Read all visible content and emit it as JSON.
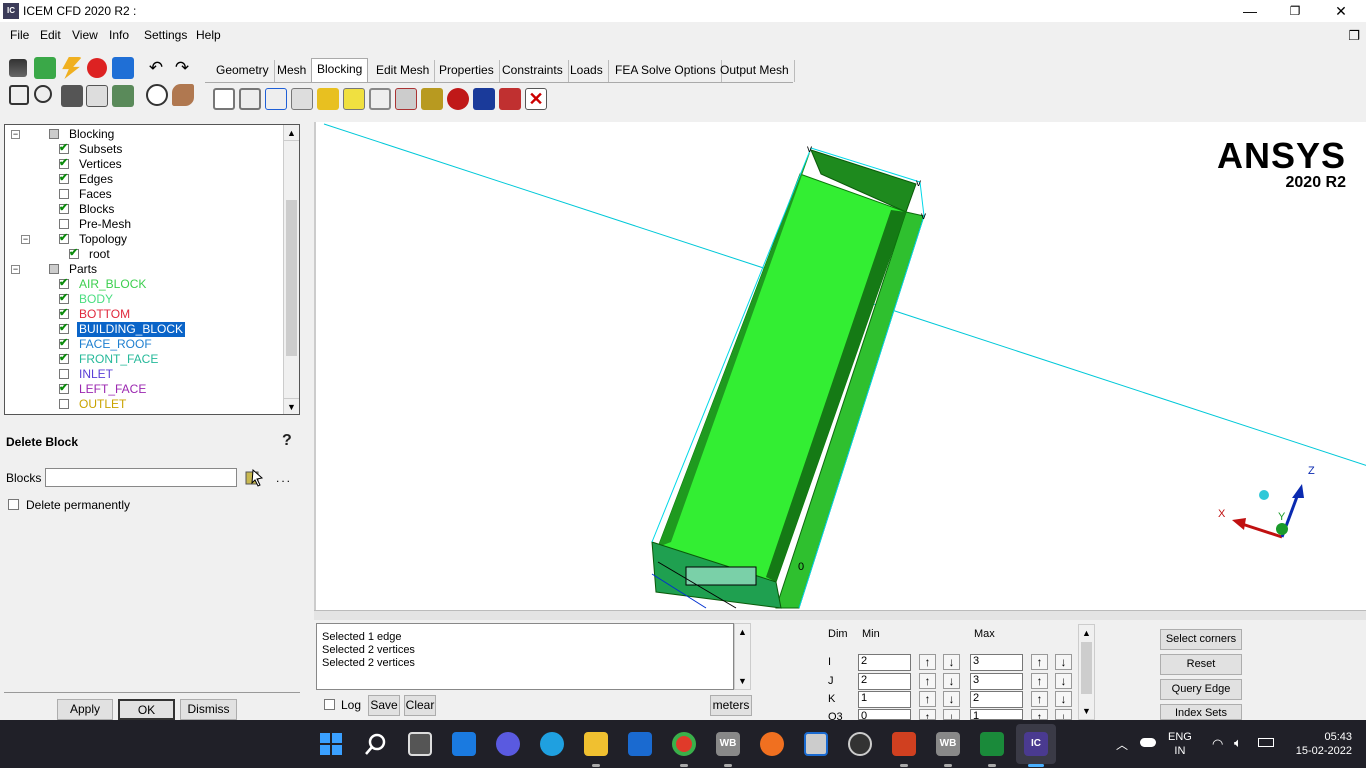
{
  "window": {
    "title": "ICEM CFD 2020 R2 :",
    "app_icon": "IC",
    "minimize": "—",
    "maximize": "❐",
    "close": "✕"
  },
  "menu": [
    "File",
    "Edit",
    "View",
    "Info",
    "Settings",
    "Help"
  ],
  "tabs": [
    {
      "label": "Geometry",
      "active": false
    },
    {
      "label": "Mesh",
      "active": false
    },
    {
      "label": "Blocking",
      "active": true
    },
    {
      "label": "Edit Mesh",
      "active": false
    },
    {
      "label": "Properties",
      "active": false
    },
    {
      "label": "Constraints",
      "active": false
    },
    {
      "label": "Loads",
      "active": false
    },
    {
      "label": "FEA Solve Options",
      "active": false
    },
    {
      "label": "Output Mesh",
      "active": false
    }
  ],
  "tree": {
    "items": [
      {
        "label": "Blocking",
        "level": 0,
        "checked": "partial",
        "expander": "⊟",
        "color": "#000000"
      },
      {
        "label": "Subsets",
        "level": 1,
        "checked": true,
        "color": "#000000"
      },
      {
        "label": "Vertices",
        "level": 1,
        "checked": true,
        "color": "#000000"
      },
      {
        "label": "Edges",
        "level": 1,
        "checked": true,
        "color": "#000000"
      },
      {
        "label": "Faces",
        "level": 1,
        "checked": false,
        "color": "#000000"
      },
      {
        "label": "Blocks",
        "level": 1,
        "checked": true,
        "color": "#000000"
      },
      {
        "label": "Pre-Mesh",
        "level": 1,
        "checked": false,
        "color": "#000000"
      },
      {
        "label": "Topology",
        "level": 1,
        "checked": true,
        "expander": "⊟",
        "color": "#000000"
      },
      {
        "label": "root",
        "level": 2,
        "checked": true,
        "color": "#000000"
      },
      {
        "label": "Parts",
        "level": 0,
        "checked": "partial",
        "expander": "⊟",
        "color": "#000000"
      },
      {
        "label": "AIR_BLOCK",
        "level": 1,
        "checked": true,
        "color": "#3ccf4e"
      },
      {
        "label": "BODY",
        "level": 1,
        "checked": true,
        "color": "#4ade80"
      },
      {
        "label": "BOTTOM",
        "level": 1,
        "checked": true,
        "color": "#e0283c"
      },
      {
        "label": "BUILDING_BLOCK",
        "level": 1,
        "checked": true,
        "color": "#ffffff",
        "selected": true
      },
      {
        "label": "FACE_ROOF",
        "level": 1,
        "checked": true,
        "color": "#1e7fd0"
      },
      {
        "label": "FRONT_FACE",
        "level": 1,
        "checked": true,
        "color": "#26b99a"
      },
      {
        "label": "INLET",
        "level": 1,
        "checked": false,
        "color": "#5a3fd6"
      },
      {
        "label": "LEFT_FACE",
        "level": 1,
        "checked": true,
        "color": "#9b27b0"
      },
      {
        "label": "OUTLET",
        "level": 1,
        "checked": false,
        "color": "#c9a300"
      }
    ]
  },
  "form": {
    "title": "Delete Block",
    "help": "?",
    "blocks_label": "Blocks",
    "blocks_value": "",
    "more": "...",
    "delete_permanently": "Delete permanently",
    "buttons": {
      "apply": "Apply",
      "ok": "OK",
      "dismiss": "Dismiss"
    }
  },
  "viewport": {
    "logo_name": "ANSYS",
    "logo_version": "2020 R2",
    "axes": {
      "x": "X",
      "y": "Y",
      "z": "Z"
    },
    "vertex_labels": [
      "0"
    ],
    "accent_green": "#33ee33",
    "line_cyan": "#00c8d8"
  },
  "messages": {
    "lines": [
      "Selected 1 edge",
      "Selected 2 vertices",
      "Selected 2 vertices"
    ],
    "log_label": "Log",
    "save": "Save",
    "clear": "Clear",
    "units": "meters"
  },
  "index_control": {
    "headers": {
      "dim": "Dim",
      "min": "Min",
      "max": "Max"
    },
    "rows": [
      {
        "dim": "I",
        "min": "2",
        "max": "3"
      },
      {
        "dim": "J",
        "min": "2",
        "max": "3"
      },
      {
        "dim": "K",
        "min": "1",
        "max": "2"
      },
      {
        "dim": "O3",
        "min": "0",
        "max": "1"
      }
    ],
    "buttons": [
      "Select corners",
      "Reset",
      "Query Edge",
      "Index Sets"
    ]
  },
  "taskbar": {
    "lang_top": "ENG",
    "lang_bottom": "IN",
    "time": "05:43",
    "date": "15-02-2022",
    "wb_label": "WB",
    "ic_label": "IC"
  }
}
